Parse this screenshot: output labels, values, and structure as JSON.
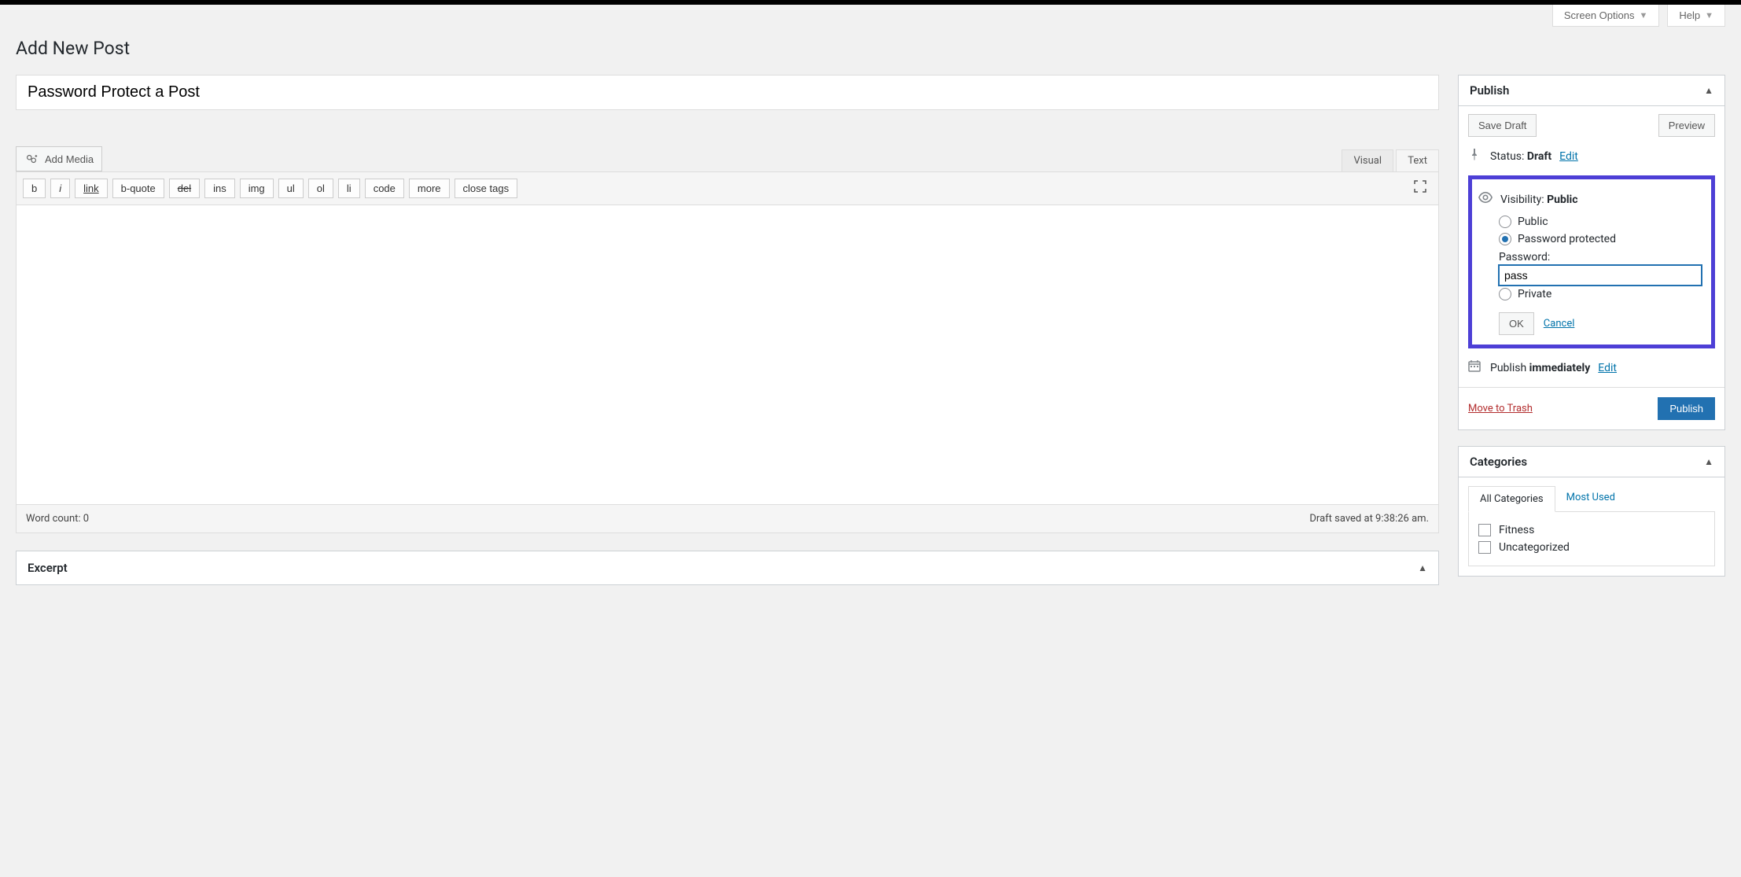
{
  "screen_meta": {
    "screen_options": "Screen Options",
    "help": "Help"
  },
  "page_title": "Add New Post",
  "post_title": "Password Protect a Post",
  "add_media": "Add Media",
  "editor_tabs": {
    "visual": "Visual",
    "text": "Text"
  },
  "quicktags": {
    "b": "b",
    "i": "i",
    "link": "link",
    "bquote": "b-quote",
    "del": "del",
    "ins": "ins",
    "img": "img",
    "ul": "ul",
    "ol": "ol",
    "li": "li",
    "code": "code",
    "more": "more",
    "close": "close tags"
  },
  "editor_status": {
    "wordcount_label": "Word count: 0",
    "draft_saved": "Draft saved at 9:38:26 am."
  },
  "publish_box": {
    "title": "Publish",
    "save_draft": "Save Draft",
    "preview": "Preview",
    "status_label": "Status:",
    "status_value": "Draft",
    "edit": "Edit",
    "visibility_label": "Visibility:",
    "visibility_value": "Public",
    "opt_public": "Public",
    "opt_password": "Password protected",
    "password_label": "Password:",
    "password_value": "pass",
    "opt_private": "Private",
    "ok": "OK",
    "cancel": "Cancel",
    "publish_label": "Publish",
    "publish_value": "immediately",
    "trash": "Move to Trash",
    "publish_btn": "Publish"
  },
  "categories_box": {
    "title": "Categories",
    "tab_all": "All Categories",
    "tab_used": "Most Used",
    "items": {
      "fitness": "Fitness",
      "uncat": "Uncategorized"
    }
  },
  "excerpt_box": {
    "title": "Excerpt"
  }
}
